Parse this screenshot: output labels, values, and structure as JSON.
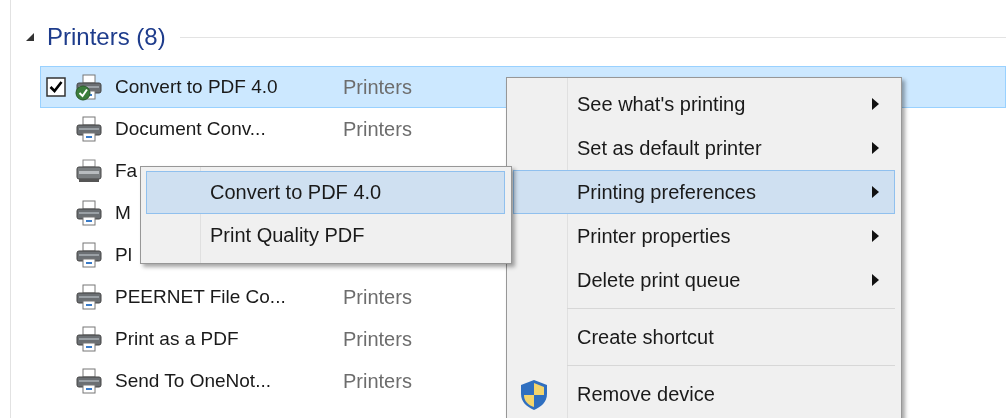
{
  "group": {
    "title": "Printers (8)",
    "expanded": true
  },
  "printers": [
    {
      "name": "Convert to PDF 4.0",
      "category": "Printers",
      "selected": true,
      "default": true,
      "kind": "printer"
    },
    {
      "name": "Document Conv...",
      "category": "Printers",
      "selected": false,
      "default": false,
      "kind": "printer"
    },
    {
      "name": "Fa",
      "selected": false,
      "default": false,
      "kind": "fax"
    },
    {
      "name": "M",
      "selected": false,
      "default": false,
      "kind": "printer"
    },
    {
      "name": "Pl",
      "selected": false,
      "default": false,
      "kind": "printer"
    },
    {
      "name": "PEERNET File Co...",
      "category": "Printers",
      "selected": false,
      "default": false,
      "kind": "printer"
    },
    {
      "name": "Print as a PDF",
      "category": "Printers",
      "selected": false,
      "default": false,
      "kind": "printer"
    },
    {
      "name": "Send To OneNot...",
      "category": "Printers",
      "selected": false,
      "default": false,
      "kind": "printer"
    }
  ],
  "context_menu": [
    {
      "kind": "submenu",
      "label": "See what's printing",
      "selected": false
    },
    {
      "kind": "submenu",
      "label": "Set as default printer",
      "selected": false
    },
    {
      "kind": "submenu",
      "label": "Printing preferences",
      "selected": true
    },
    {
      "kind": "submenu",
      "label": "Printer properties",
      "selected": false
    },
    {
      "kind": "submenu",
      "label": "Delete print queue",
      "selected": false
    },
    {
      "kind": "separator"
    },
    {
      "kind": "command",
      "label": "Create shortcut",
      "selected": false
    },
    {
      "kind": "separator"
    },
    {
      "kind": "admin",
      "label": "Remove device",
      "selected": false
    }
  ],
  "submenu": [
    {
      "label": "Convert to PDF 4.0",
      "selected": true
    },
    {
      "label": "Print Quality PDF",
      "selected": false
    }
  ]
}
